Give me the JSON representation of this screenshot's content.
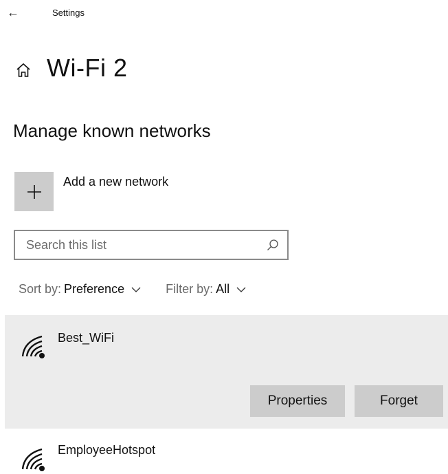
{
  "titlebar": {
    "back_glyph": "←",
    "title": "Settings"
  },
  "page": {
    "home_icon": "home-icon",
    "title": "Wi-Fi 2"
  },
  "section": {
    "title": "Manage known networks"
  },
  "add_network": {
    "icon": "plus-icon",
    "label": "Add a new network"
  },
  "search": {
    "placeholder": "Search this list",
    "value": "",
    "icon": "search-icon"
  },
  "sort": {
    "prefix": "Sort by:",
    "value": "Preference"
  },
  "filter": {
    "prefix": "Filter by:",
    "value": "All"
  },
  "networks": [
    {
      "name": "Best_WiFi",
      "icon": "wifi-secure-icon",
      "selected": true,
      "actions": {
        "properties": "Properties",
        "forget": "Forget"
      }
    },
    {
      "name": "EmployeeHotspot",
      "icon": "wifi-secure-icon",
      "selected": false
    }
  ],
  "colors": {
    "tile_bg": "#cccccc",
    "selected_bg": "#ececec",
    "border": "#8a8a8a"
  }
}
